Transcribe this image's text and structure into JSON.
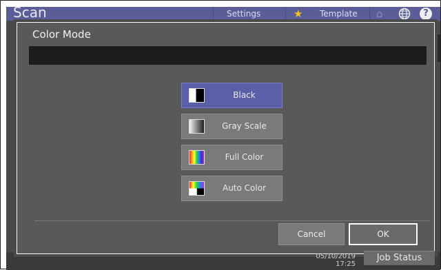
{
  "header": {
    "app_title": "Scan",
    "tabs": [
      {
        "label": "Settings"
      },
      {
        "label": "Template"
      }
    ],
    "icons": [
      "star-icon",
      "home-icon",
      "globe-icon",
      "help-icon"
    ],
    "help_glyph": "?"
  },
  "dialog": {
    "title": "Color Mode",
    "options": [
      {
        "label": "Black",
        "icon": "black-white-swatch-icon",
        "selected": true
      },
      {
        "label": "Gray Scale",
        "icon": "grayscale-swatch-icon",
        "selected": false
      },
      {
        "label": "Full Color",
        "icon": "full-color-swatch-icon",
        "selected": false
      },
      {
        "label": "Auto Color",
        "icon": "auto-color-swatch-icon",
        "selected": false
      }
    ],
    "cancel_label": "Cancel",
    "ok_label": "OK"
  },
  "footer": {
    "date": "05/10/2019",
    "time": "17:25",
    "job_status_label": "Job Status"
  },
  "colors": {
    "header": "#5b5d98",
    "selected_option": "#5b5fa8",
    "dialog_bg": "#595959",
    "option_bg": "#7a7a7a"
  }
}
